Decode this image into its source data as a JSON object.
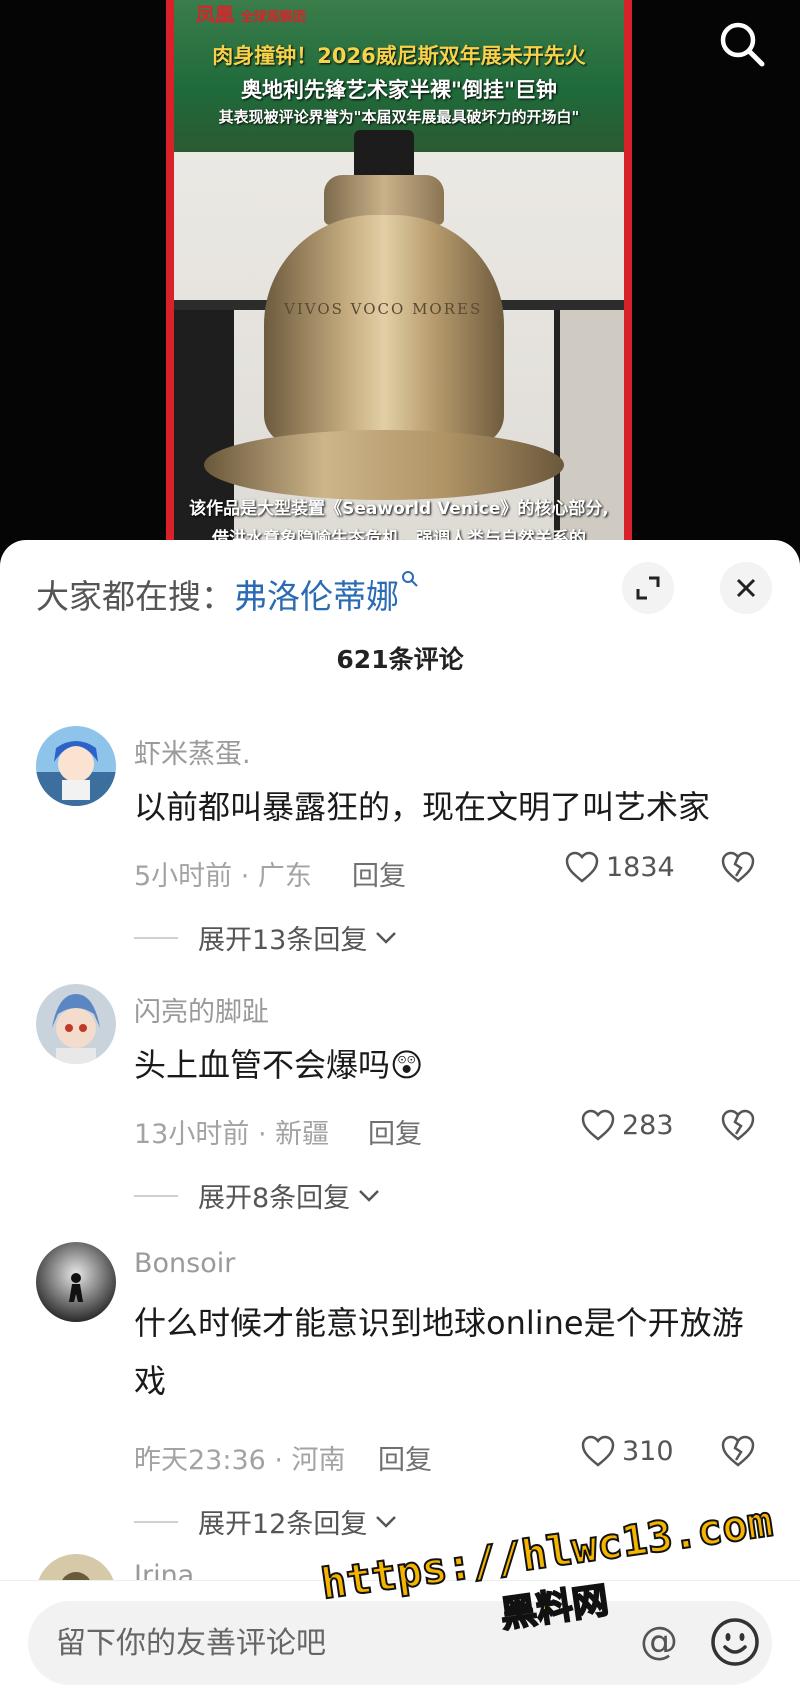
{
  "video": {
    "brand_name": "凤凰",
    "brand_sub": "全球观察团",
    "headline_1": "肉身撞钟！2026威尼斯双年展未开先火",
    "headline_2": "奥地利先锋艺术家半裸\"倒挂\"巨钟",
    "headline_3": "其表现被评论界誉为\"本届双年展最具破坏力的开场白\"",
    "bell_inscription": "VIVOS VOCO MORES",
    "caption_1": "该作品是大型装置《Seaworld Venice》的核心部分,",
    "caption_2": "借洪水意象隐喻生态危机，强调人类与自然关系的"
  },
  "sheet": {
    "trending_prefix": "大家都在搜：",
    "trending_term": "弗洛伦蒂娜",
    "comment_count": "621条评论"
  },
  "comments": [
    {
      "username": "虾米蒸蛋.",
      "text": "以前都叫暴露狂的，现在文明了叫艺术家",
      "time_location": "5小时前 · 广东",
      "reply_label": "回复",
      "likes": "1834",
      "expand_label": "展开13条回复"
    },
    {
      "username": "闪亮的脚趾",
      "text": "头上血管不会爆吗😲",
      "time_location": "13小时前 · 新疆",
      "reply_label": "回复",
      "likes": "283",
      "expand_label": "展开8条回复"
    },
    {
      "username": "Bonsoir",
      "text": "什么时候才能意识到地球online是个开放游戏",
      "time_location": "昨天23:36 · 河南",
      "reply_label": "回复",
      "likes": "310",
      "expand_label": "展开12条回复"
    },
    {
      "username": "Irina"
    }
  ],
  "input": {
    "placeholder": "留下你的友善评论吧"
  },
  "watermark": {
    "url": "https://hlwc13.com",
    "name": "黑料网"
  },
  "colors": {
    "trending_blue": "#2a6bb3",
    "frame_red": "#d8222a",
    "watermark_yellow": "#f4b400"
  }
}
